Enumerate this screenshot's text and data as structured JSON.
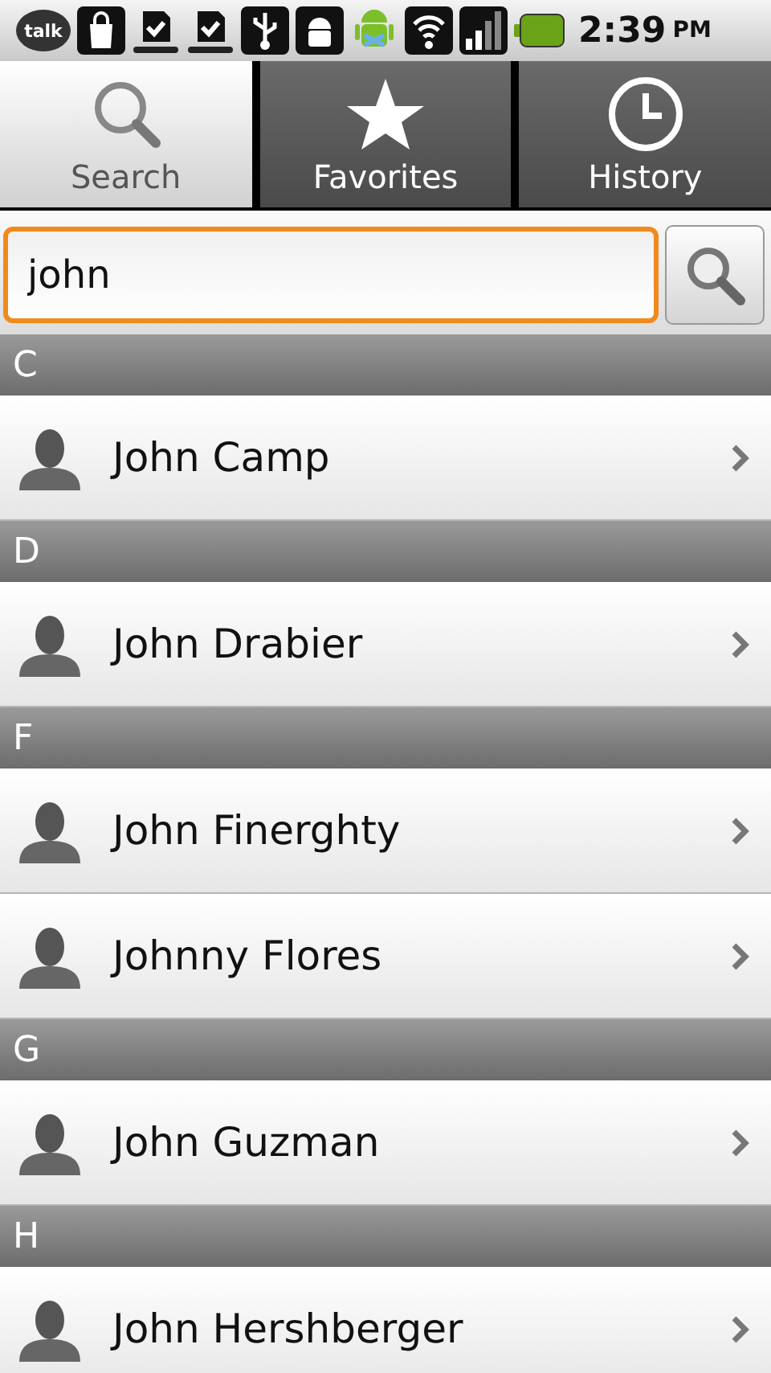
{
  "status_bar": {
    "talk_label": "talk",
    "time": "2:39",
    "meridiem": "PM"
  },
  "tabs": [
    {
      "label": "Search",
      "selected": true
    },
    {
      "label": "Favorites",
      "selected": false
    },
    {
      "label": "History",
      "selected": false
    }
  ],
  "search": {
    "value": "john"
  },
  "sections": [
    {
      "letter": "C",
      "contacts": [
        {
          "name": "John Camp"
        }
      ]
    },
    {
      "letter": "D",
      "contacts": [
        {
          "name": "John Drabier"
        }
      ]
    },
    {
      "letter": "F",
      "contacts": [
        {
          "name": "John Finerghty"
        },
        {
          "name": "Johnny Flores"
        }
      ]
    },
    {
      "letter": "G",
      "contacts": [
        {
          "name": "John Guzman"
        }
      ]
    },
    {
      "letter": "H",
      "contacts": [
        {
          "name": "John Hershberger"
        }
      ]
    }
  ]
}
